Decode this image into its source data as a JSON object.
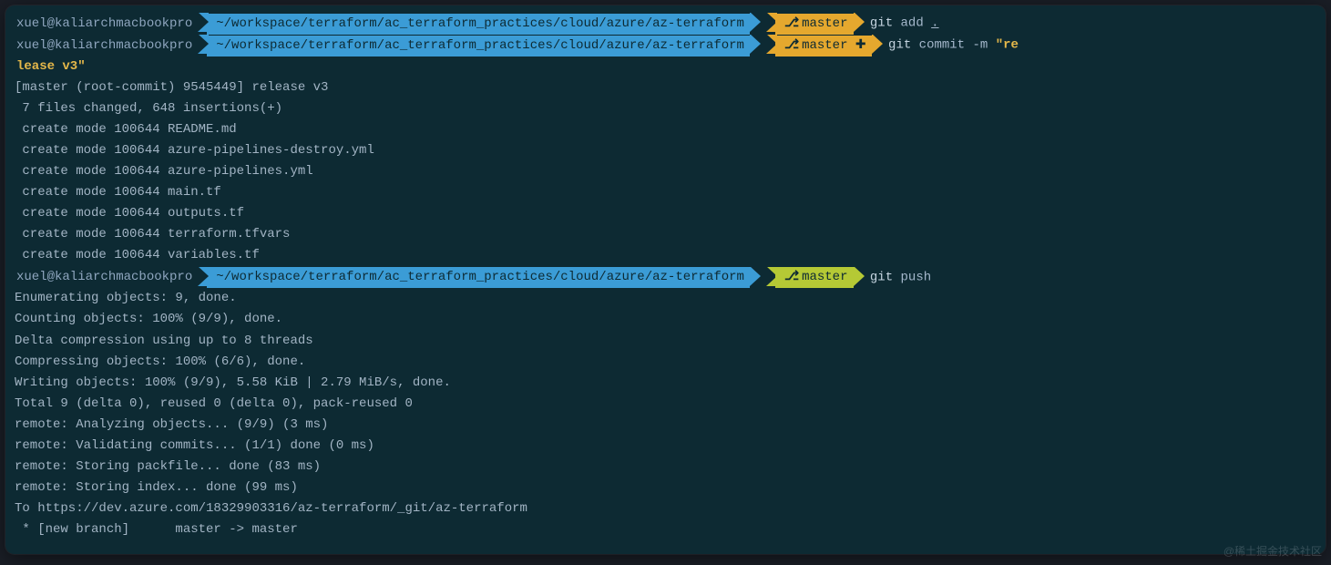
{
  "prompt1": {
    "userhost": "xuel@kaliarchmacbookpro",
    "path": "~/workspace/terraform/ac_terraform_practices/cloud/azure/az-terraform",
    "branch_icon": "⎇",
    "branch": "master",
    "cmd_git": "git",
    "cmd_rest": "add ",
    "cmd_dot": "."
  },
  "prompt2": {
    "userhost": "xuel@kaliarchmacbookpro",
    "path": "~/workspace/terraform/ac_terraform_practices/cloud/azure/az-terraform",
    "branch_icon": "⎇",
    "branch": "master",
    "branch_plus": "✚",
    "cmd_git": "git",
    "cmd_commit": "commit -m ",
    "cmd_msg_start": "\"re",
    "cmd_msg_wrap": "lease v3\""
  },
  "commit_output": {
    "l1": "[master (root-commit) 9545449] release v3",
    "l2": " 7 files changed, 648 insertions(+)",
    "l3": " create mode 100644 README.md",
    "l4": " create mode 100644 azure-pipelines-destroy.yml",
    "l5": " create mode 100644 azure-pipelines.yml",
    "l6": " create mode 100644 main.tf",
    "l7": " create mode 100644 outputs.tf",
    "l8": " create mode 100644 terraform.tfvars",
    "l9": " create mode 100644 variables.tf"
  },
  "prompt3": {
    "userhost": "xuel@kaliarchmacbookpro",
    "path": "~/workspace/terraform/ac_terraform_practices/cloud/azure/az-terraform",
    "branch_icon": "⎇",
    "branch": "master",
    "cmd_git": "git",
    "cmd_push": "push"
  },
  "push_output": {
    "l1": "Enumerating objects: 9, done.",
    "l2": "Counting objects: 100% (9/9), done.",
    "l3": "Delta compression using up to 8 threads",
    "l4": "Compressing objects: 100% (6/6), done.",
    "l5": "Writing objects: 100% (9/9), 5.58 KiB | 2.79 MiB/s, done.",
    "l6": "Total 9 (delta 0), reused 0 (delta 0), pack-reused 0",
    "l7": "remote: Analyzing objects... (9/9) (3 ms)",
    "l8": "remote: Validating commits... (1/1) done (0 ms)",
    "l9": "remote: Storing packfile... done (83 ms)",
    "l10": "remote: Storing index... done (99 ms)",
    "l11": "To https://dev.azure.com/18329903316/az-terraform/_git/az-terraform",
    "l12": " * [new branch]      master -> master"
  },
  "watermark": "@稀土掘金技术社区"
}
